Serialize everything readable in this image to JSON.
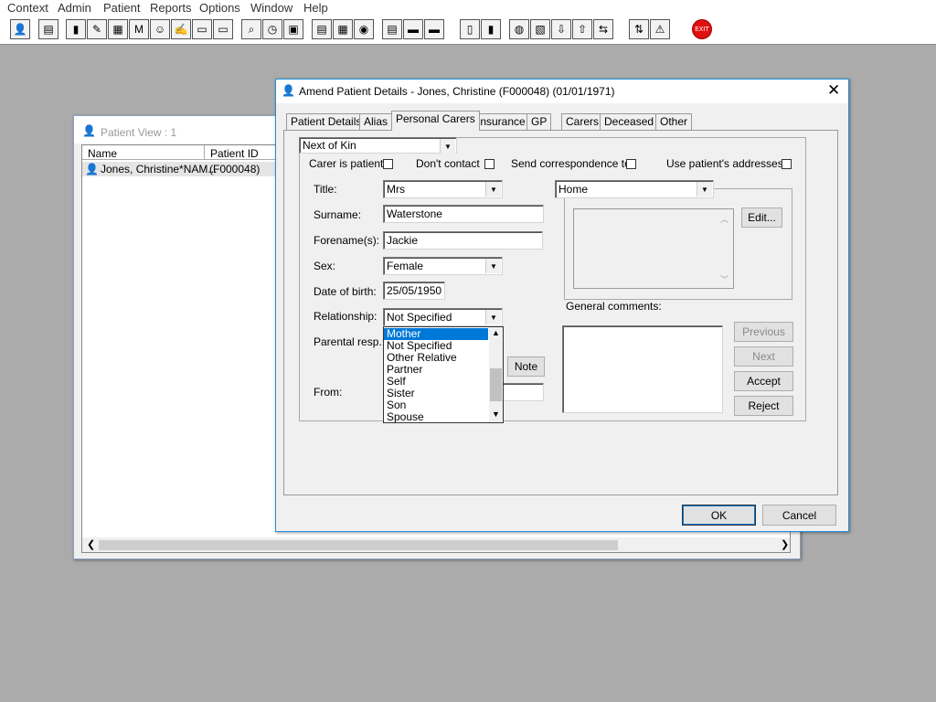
{
  "menu": [
    "Context",
    "Admin",
    "Patient",
    "Reports",
    "Options",
    "Window",
    "Help"
  ],
  "toolbar_icons": [
    "patient-icon",
    "printer-icon",
    "book-icon",
    "notes-icon",
    "edit-icon",
    "mail-icon",
    "doctor-icon",
    "pen-icon",
    "car-icon",
    "car-alt-icon",
    "search-icon",
    "clock-icon",
    "monitor-icon",
    "id-card-icon",
    "calendar-icon",
    "globe-check-icon",
    "document-icon",
    "ambulance-icon",
    "ambulance-alt-icon",
    "page-icon",
    "chart-icon",
    "globe-icon",
    "export-icon",
    "download-icon",
    "upload-icon",
    "transfer-icon",
    "warning-icon",
    "exit-icon"
  ],
  "patient_view": {
    "title": "Patient View : 1",
    "col_name": "Name",
    "col_id": "Patient ID",
    "row_name": "Jones, Christine*NAM...",
    "row_id": "(F000048)"
  },
  "dialog": {
    "title": "Amend Patient Details - Jones, Christine (F000048) (01/01/1971)",
    "tabs": [
      "Patient Details",
      "Alias",
      "Personal Carers",
      "Insurance",
      "GP",
      "Carers",
      "Deceased",
      "Other"
    ],
    "active_tab": "Personal Carers",
    "carer_type": "Next of Kin",
    "checks": {
      "carer_is_patient": "Carer is patient",
      "dont_contact": "Don't contact",
      "send_correspondence": "Send correspondence to",
      "use_patient_addresses": "Use patient's addresses"
    },
    "labels": {
      "title": "Title:",
      "surname": "Surname:",
      "forename": "Forename(s):",
      "sex": "Sex:",
      "dob": "Date of birth:",
      "relationship": "Relationship:",
      "parental": "Parental resp.:",
      "from": "From:",
      "general_comments": "General comments:"
    },
    "values": {
      "title": "Mrs",
      "surname": "Waterstone",
      "forename": "Jackie",
      "sex": "Female",
      "dob": "25/05/1950",
      "relationship": "Not Specified",
      "address_type": "Home"
    },
    "relationship_options": [
      "Mother",
      "Not Specified",
      "Other Relative",
      "Partner",
      "Self",
      "Sister",
      "Son",
      "Spouse"
    ],
    "relationship_highlight": "Mother",
    "buttons": {
      "edit": "Edit...",
      "note": "Note",
      "previous": "Previous",
      "next": "Next",
      "accept": "Accept",
      "reject": "Reject",
      "ok": "OK",
      "cancel": "Cancel"
    }
  },
  "colors": {
    "desktop": "#ababab",
    "selection": "#0078d7",
    "window_face": "#f0f0f0"
  }
}
